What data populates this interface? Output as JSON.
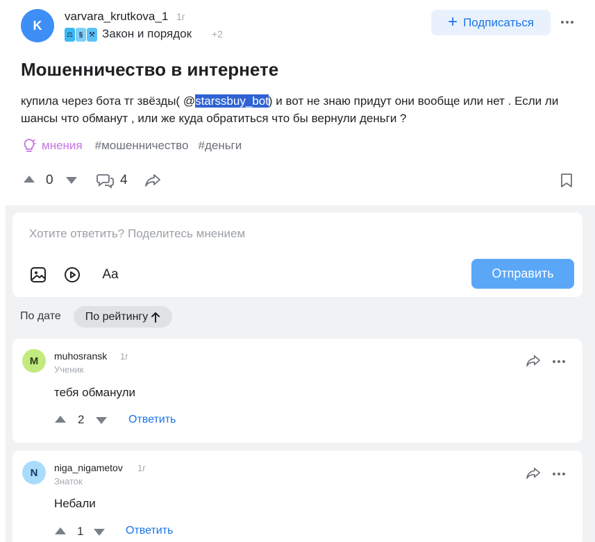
{
  "post": {
    "avatar_letter": "K",
    "author": "varvara_krutkova_1",
    "time": "1г",
    "category": "Закон и порядок",
    "more_categories": "+2",
    "subscribe_label": "Подписаться",
    "title": "Мошенничество в интернете",
    "body_before": "купила через бота тг звёзды( @",
    "mention": "starssbuy_bot",
    "body_after": ") и вот не знаю придут они вообще или нет . Если ли шансы что обманут , или же куда обратиться что бы вернули деньги ?",
    "tags": [
      "мнения",
      "#мошенничество",
      "#деньги"
    ],
    "score": "0",
    "comments_count": "4",
    "icons": [
      "lightbulb-icon",
      "upvote-icon",
      "downvote-icon",
      "comment-icon",
      "share-icon",
      "bookmark-icon",
      "more-icon"
    ]
  },
  "reply": {
    "placeholder": "Хотите ответить? Поделитесь мнением",
    "text_format_label": "Aa",
    "send_label": "Отправить"
  },
  "sort": {
    "by_date": "По дате",
    "by_rating": "По рейтингу"
  },
  "comments": [
    {
      "avatar_letter": "M",
      "avatar_color": "#c3ea7f",
      "user": "muhosransk",
      "time": "1г",
      "rank": "Ученик",
      "text": "тебя обманули",
      "score": "2",
      "reply_label": "Ответить"
    },
    {
      "avatar_letter": "N",
      "avatar_color": "#a9dcfb",
      "user": "niga_nigametov",
      "time": "1г",
      "rank": "Знаток",
      "text": "Небали",
      "score": "1",
      "reply_label": "Ответить"
    }
  ],
  "colors": {
    "accent": "#1a73e8",
    "send_button": "#5aa7f7",
    "mention_highlight": "#2f63d3",
    "opinion_tag": "#c474e2",
    "feed_background": "#f1f2f4"
  }
}
